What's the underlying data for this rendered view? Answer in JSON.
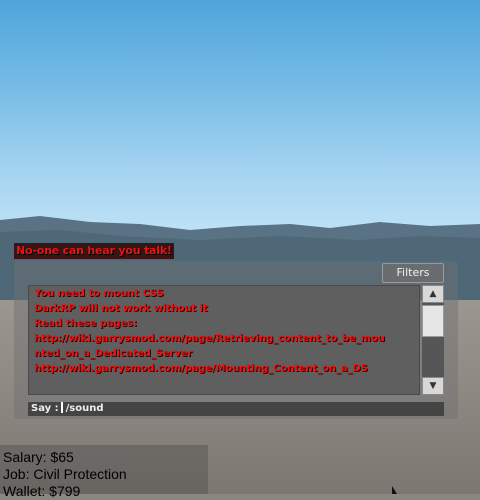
{
  "warning": "No-one can hear you talk!",
  "chat": {
    "filters_label": "Filters",
    "lines": [
      "You need to mount CSS",
      "DarkRP will not work without it",
      "Read these pages:",
      "http://wiki.garrysmod.com/page/Retrieving_content_to_be_mou",
      "nted_on_a_Dedicated_Server",
      "http://wiki.garrysmod.com/page/Mounting_Content_on_a_DS"
    ],
    "say_label": "Say :",
    "say_value": "/sound",
    "text_color": "#e01818"
  },
  "hud": {
    "salary": "Salary: $65",
    "job": "Job: Civil Protection",
    "wallet": "Wallet: $799"
  },
  "icons": {
    "scroll_up": "arrow-up-icon",
    "scroll_down": "arrow-down-icon"
  }
}
